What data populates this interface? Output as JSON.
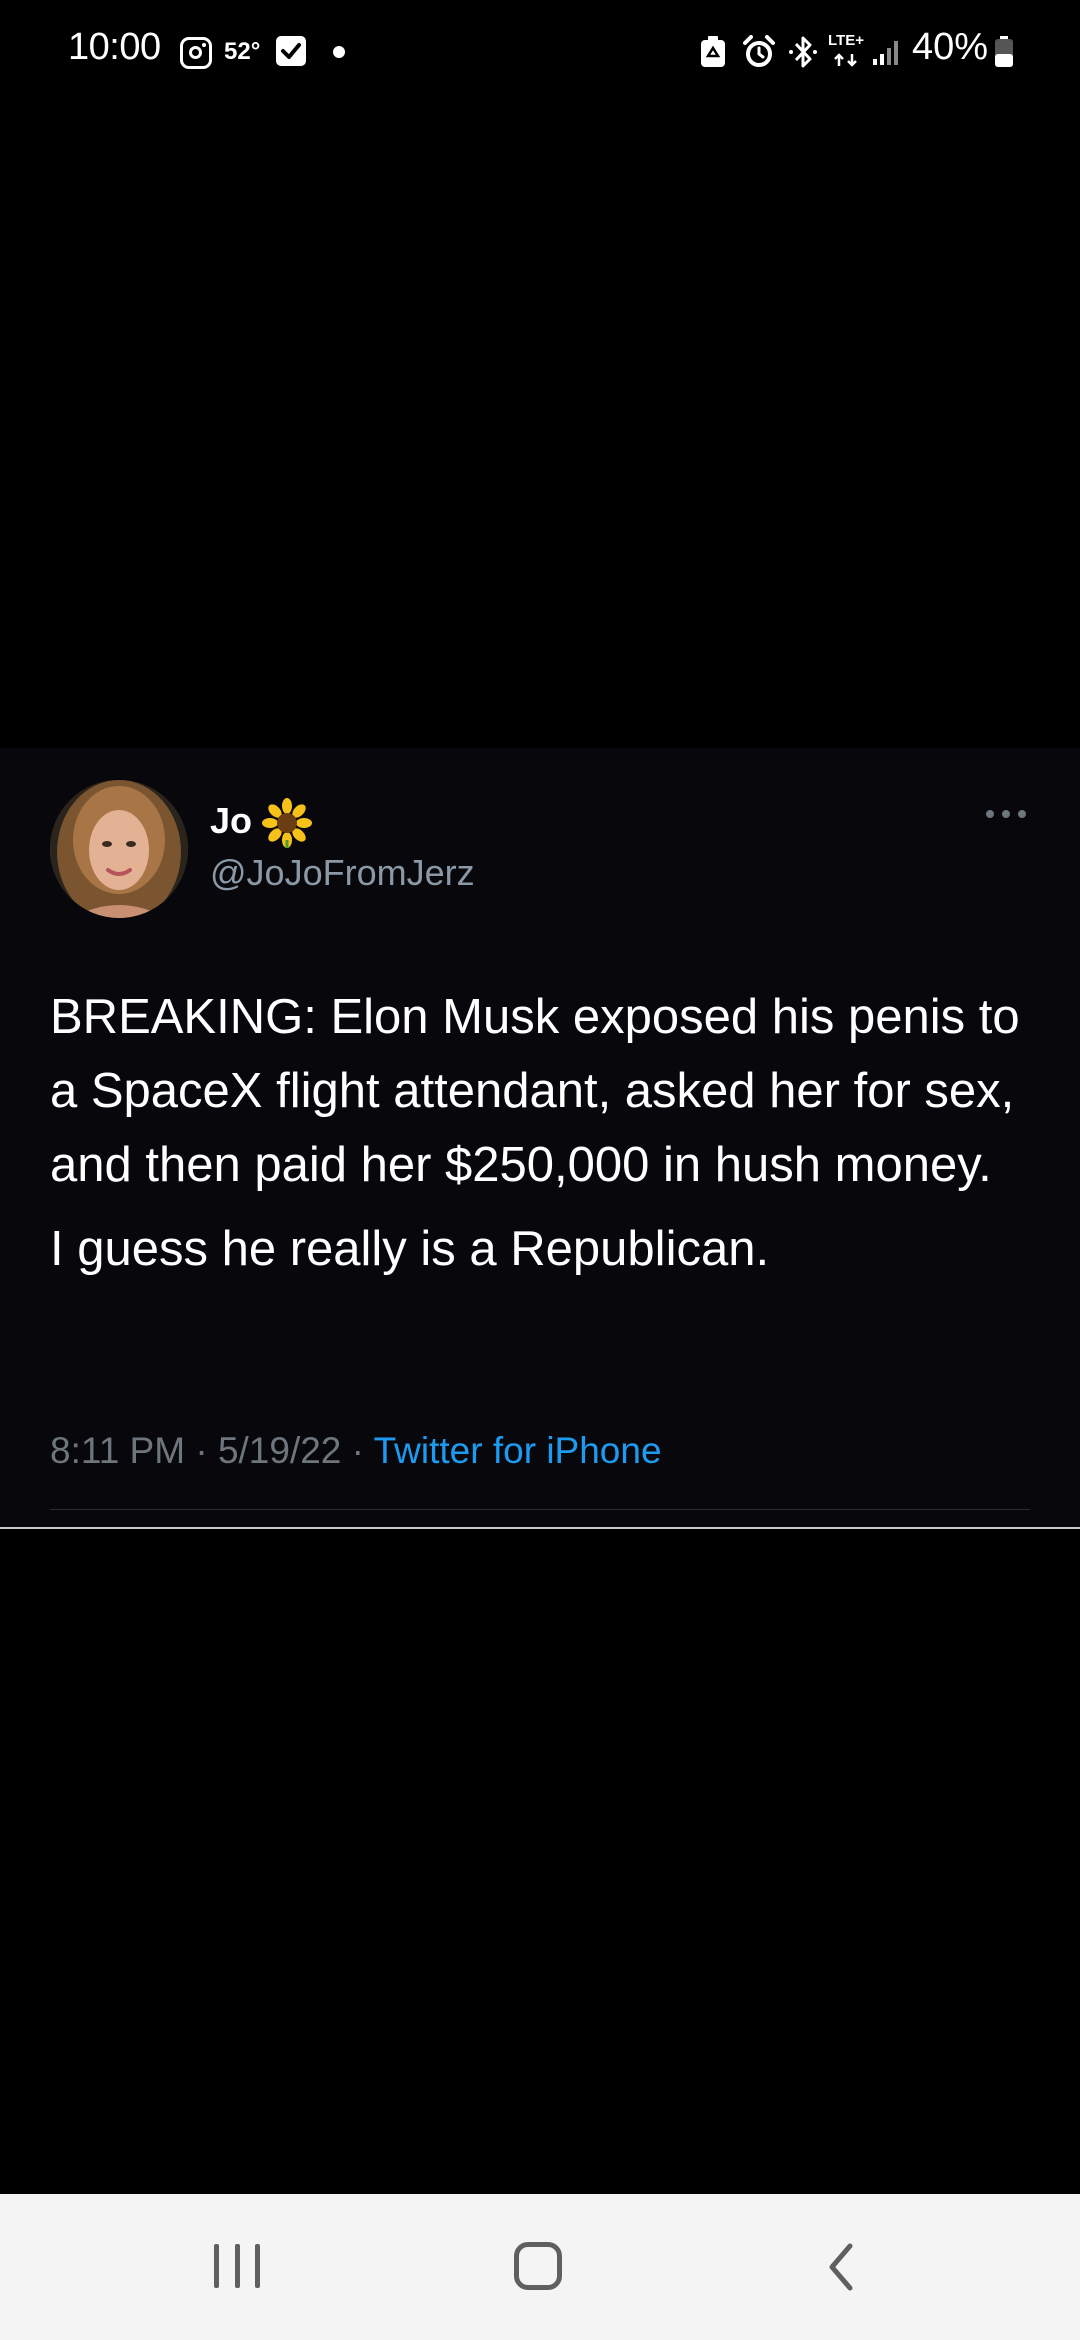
{
  "status_bar": {
    "time": "10:00",
    "temperature": "52°",
    "battery_percent": "40%",
    "network": "LTE+",
    "icons_left": [
      "instagram-icon",
      "checkbox-notification-icon",
      "notification-dot"
    ],
    "icons_right": [
      "recycle-icon",
      "alarm-icon",
      "bluetooth-icon",
      "lte-plus-icon",
      "signal-icon",
      "battery-icon"
    ]
  },
  "tweet": {
    "display_name": "Jo",
    "name_emoji": "sunflower-icon",
    "handle": "@JoJoFromJerz",
    "paragraphs": [
      "BREAKING: Elon Musk exposed his penis to a SpaceX flight attendant, asked her for sex, and then paid her $250,000 in hush money.",
      "I guess he really is a Republican."
    ],
    "time": "8:11 PM",
    "separator": "·",
    "date": "5/19/22",
    "source": "Twitter for iPhone"
  },
  "nav_bar": {
    "buttons": [
      "recents-button",
      "home-button",
      "back-button"
    ]
  },
  "colors": {
    "background": "#000000",
    "card_background": "#08080c",
    "secondary_text": "#6e767d",
    "handle_text": "#8b98a5",
    "link": "#1d9bf0",
    "nav_background": "#f4f4f4"
  }
}
